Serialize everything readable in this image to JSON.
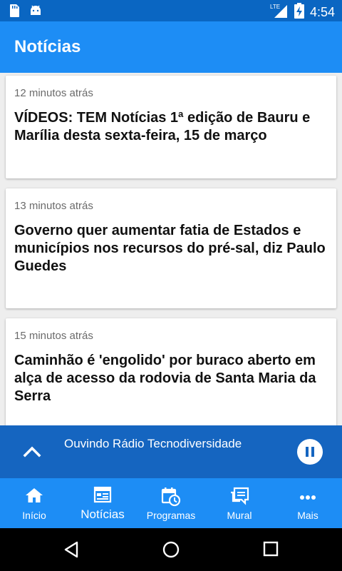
{
  "status_bar": {
    "time": "4:54",
    "network": "LTE",
    "icons": [
      "sd-card-icon",
      "android-icon",
      "lte-signal-icon",
      "battery-charging-icon"
    ]
  },
  "app_bar": {
    "title": "Notícias"
  },
  "feed": {
    "items": [
      {
        "time": "12 minutos atrás",
        "headline": "VÍDEOS: TEM Notícias 1ª edição de Bauru e Marília desta sexta-feira, 15 de março"
      },
      {
        "time": "13 minutos atrás",
        "headline": "Governo quer aumentar fatia de Estados e municípios nos recursos do pré-sal, diz Paulo Guedes"
      },
      {
        "time": "15 minutos atrás",
        "headline": "Caminhão é 'engolido' por buraco aberto em alça de acesso da rodovia de Santa Maria da Serra"
      }
    ]
  },
  "player": {
    "label": "Ouvindo Rádio Tecnodiversidade",
    "state": "playing"
  },
  "bottom_nav": {
    "items": [
      {
        "label": "Início",
        "icon": "home-icon"
      },
      {
        "label": "Notícias",
        "icon": "news-icon",
        "active": true
      },
      {
        "label": "Programas",
        "icon": "calendar-clock-icon"
      },
      {
        "label": "Mural",
        "icon": "chat-icon"
      },
      {
        "label": "Mais",
        "icon": "more-icon"
      }
    ]
  },
  "colors": {
    "status_bar": "#0a66c2",
    "app_bar": "#1d8df5",
    "player": "#1565c0",
    "bottom_nav": "#1d8df5",
    "background": "#eeeeee"
  }
}
